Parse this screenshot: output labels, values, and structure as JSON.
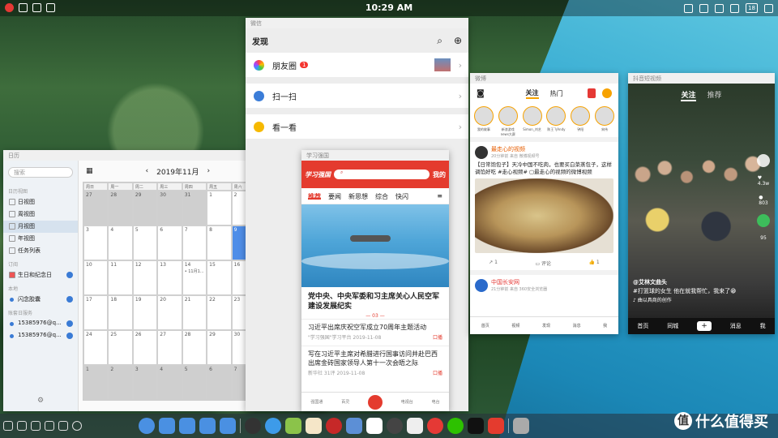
{
  "status_bar": {
    "time": "10:29 AM",
    "battery": "18"
  },
  "calendar": {
    "window_title": "日历",
    "search_placeholder": "搜索",
    "month_label": "2019年11月",
    "sec_views": "日历视图",
    "views": [
      "日视图",
      "周视图",
      "月视图",
      "年视图",
      "任务列表"
    ],
    "sec_subs": "订阅",
    "subs": [
      "生日和纪念日"
    ],
    "sec_local": "本地",
    "local": [
      "闪念胶囊"
    ],
    "sec_accounts": "账套日服务",
    "accounts": [
      "15385976@q...",
      "15385976@q..."
    ],
    "weekdays": [
      "周日",
      "周一",
      "周二",
      "周三",
      "周四",
      "周五",
      "周六"
    ],
    "days": [
      [
        "27",
        "28",
        "29",
        "30",
        "31",
        "1",
        "2"
      ],
      [
        "3",
        "4",
        "5",
        "6",
        "7",
        "8",
        "9"
      ],
      [
        "10",
        "11",
        "12",
        "13",
        "14",
        "15",
        "16"
      ],
      [
        "17",
        "18",
        "19",
        "20",
        "21",
        "22",
        "23"
      ],
      [
        "24",
        "25",
        "26",
        "27",
        "28",
        "29",
        "30"
      ],
      [
        "1",
        "2",
        "3",
        "4",
        "5",
        "6",
        "7"
      ]
    ],
    "event": "• 11月1...",
    "today_label": "9 十三"
  },
  "wechat": {
    "window_title": "微信",
    "header": "发现",
    "rows": [
      "朋友圈",
      "扫一扫",
      "看一看"
    ],
    "badge": "1"
  },
  "xuexi": {
    "window_title": "学习强国",
    "logo": "学习强国",
    "my": "我的",
    "tabs": [
      "推荐",
      "要闻",
      "新思想",
      "综合",
      "快闪"
    ],
    "headline": "党中央、中央军委和习主席关心人民空军建设发展纪实",
    "num": "— 03 —",
    "articles": [
      {
        "title": "习近平出席庆祝空军成立70周年主题活动",
        "src": "\"学习强国\"学习平台  2019-11-08",
        "play": "口播"
      },
      {
        "title": "写在习近平主席对希腊进行国事访问并赴巴西出席金砖国家领导人第十一次会晤之际",
        "src": "新华社  31评  2019-11-08",
        "play": "口播"
      }
    ],
    "nav": [
      "强国通",
      "百灵",
      "",
      "电视台",
      "电台"
    ]
  },
  "weibo": {
    "window_title": "微博",
    "tabs": [
      "关注",
      "热门"
    ],
    "avatars": [
      "我的故事",
      "新浪游戏news大赛",
      "Simon_刘艺",
      "陈王飞Andy",
      "钟阳",
      "宋伟"
    ],
    "post": {
      "user": "最走心的视频",
      "sub": "20分钟前  来自 微博视频号",
      "text": "【日常饱包子】天冷中国不吃肉，也要买白菜蒸包子，这样调馅好吃 #走心视频# ▢最走心的视频的微博视频",
      "repost": "1",
      "comment": "评论",
      "like": "1"
    },
    "post2": {
      "user": "中国长安网",
      "sub": "21分钟前  来自 360安全浏览器"
    },
    "nav": [
      "首页",
      "视频",
      "发现",
      "消息",
      "我"
    ]
  },
  "douyin": {
    "window_title": "抖音短视频",
    "tabs": [
      "关注",
      "推荐"
    ],
    "likes": "4.3w",
    "comments": "803",
    "shares": "95",
    "caption": "@艾林文曲头",
    "caption2": "#打篮球的女生 他在就我帮忙，我来了😁",
    "caption3": "♪ 曲以具商的创作",
    "nav": [
      "首页",
      "同城",
      "+",
      "消息",
      "我"
    ]
  },
  "watermark": "什么值得买"
}
